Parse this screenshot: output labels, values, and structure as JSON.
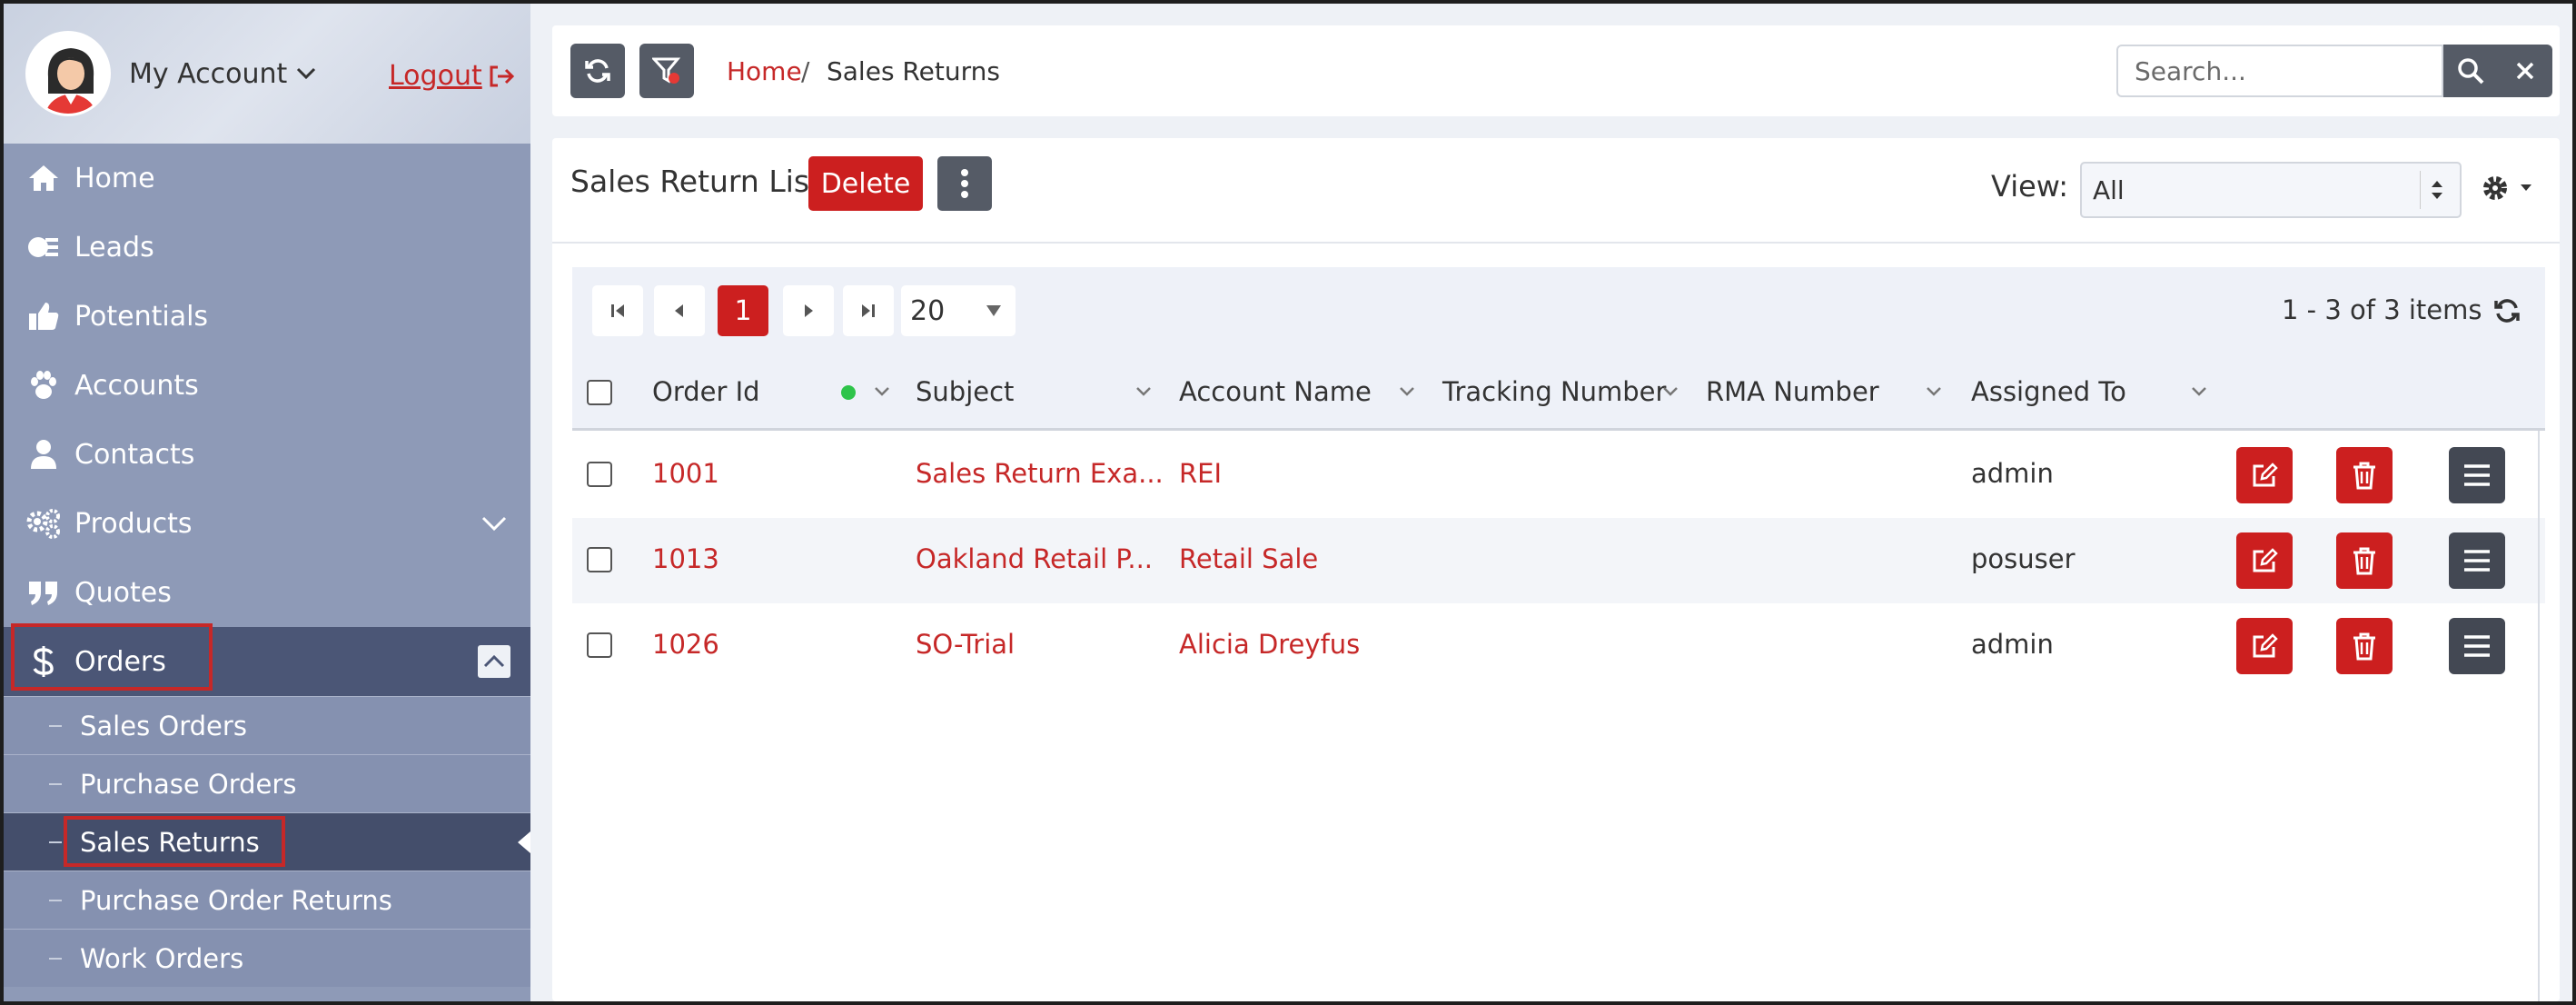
{
  "account": {
    "label": "My Account",
    "logout": "Logout"
  },
  "nav": {
    "home": "Home",
    "leads": "Leads",
    "potentials": "Potentials",
    "accounts": "Accounts",
    "contacts": "Contacts",
    "products": "Products",
    "quotes": "Quotes",
    "orders": "Orders",
    "sub": {
      "sales_orders": "Sales Orders",
      "purchase_orders": "Purchase Orders",
      "sales_returns": "Sales Returns",
      "purchase_order_returns": "Purchase Order Returns",
      "work_orders": "Work Orders"
    }
  },
  "breadcrumb": {
    "home": "Home",
    "sep": "/",
    "current": "Sales Returns"
  },
  "search": {
    "placeholder": "Search..."
  },
  "list": {
    "title": "Sales Return List",
    "delete_label": "Delete",
    "view_label": "View:",
    "view_value": "All"
  },
  "pager": {
    "current_page": "1",
    "page_size": "20",
    "info": "1 - 3 of 3 items"
  },
  "columns": {
    "order_id": "Order Id",
    "subject": "Subject",
    "account_name": "Account Name",
    "tracking_number": "Tracking Number",
    "rma_number": "RMA Number",
    "assigned_to": "Assigned To"
  },
  "rows": [
    {
      "order_id": "1001",
      "subject": "Sales Return Exa...",
      "account_name": "REI",
      "tracking_number": "",
      "rma_number": "",
      "assigned_to": "admin"
    },
    {
      "order_id": "1013",
      "subject": "Oakland Retail P...",
      "account_name": "Retail Sale",
      "tracking_number": "",
      "rma_number": "",
      "assigned_to": "posuser"
    },
    {
      "order_id": "1026",
      "subject": "SO-Trial",
      "account_name": "Alicia Dreyfus",
      "tracking_number": "",
      "rma_number": "",
      "assigned_to": "admin"
    }
  ],
  "colors": {
    "accent": "#cc1f1f",
    "sidebar": "#8e9ab7",
    "sidebar_active": "#4b5676",
    "dark_button": "#555b66",
    "status_dot": "#2ec44a"
  }
}
